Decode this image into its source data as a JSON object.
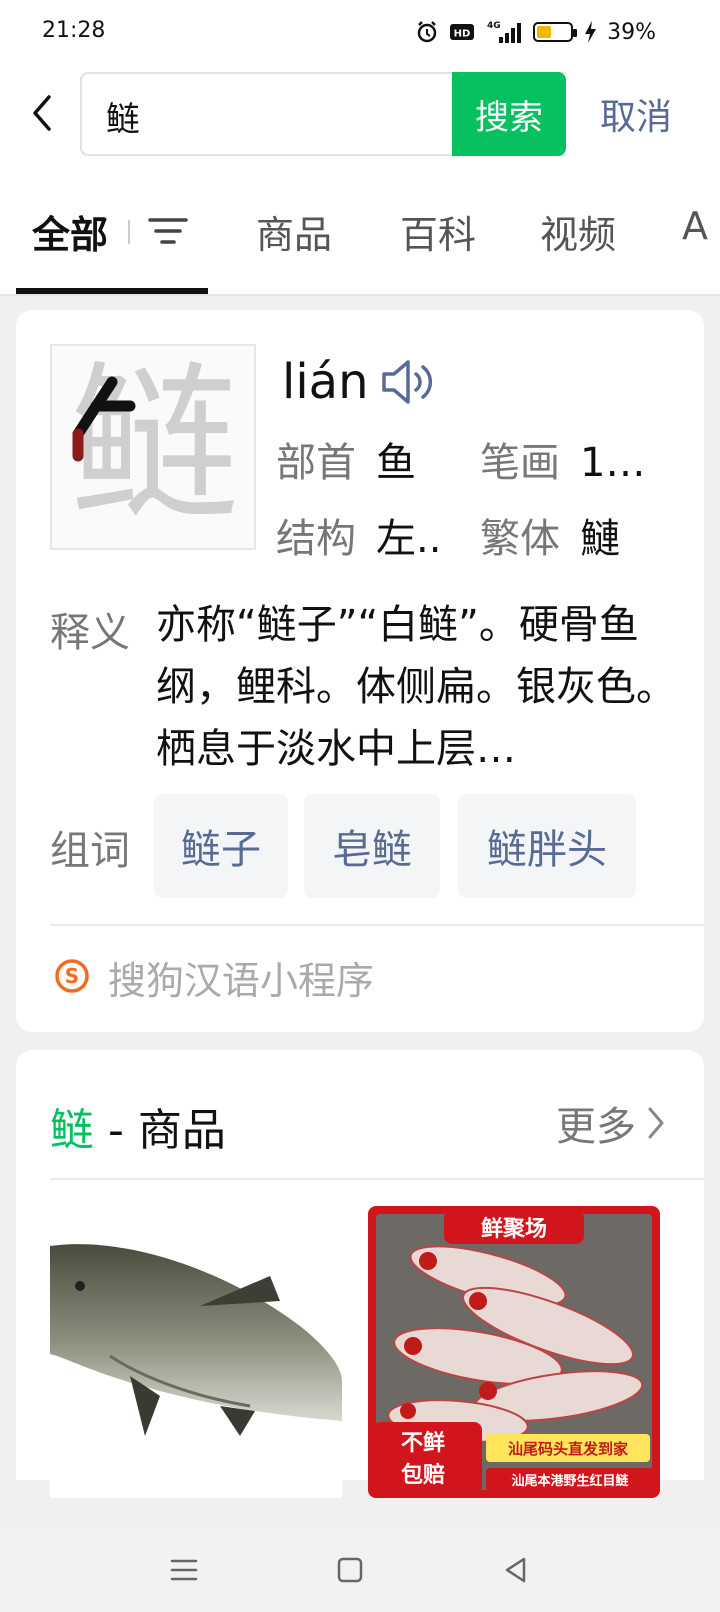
{
  "status_bar": {
    "time": "21:28",
    "battery_text": "39%",
    "battery_level": 0.39,
    "icons": [
      "alarm-icon",
      "hd-icon",
      "4g-signal-icon",
      "battery-icon",
      "charging-icon"
    ]
  },
  "search": {
    "query": "鲢",
    "search_label": "搜索",
    "cancel_label": "取消"
  },
  "tabs": [
    {
      "label": "全部",
      "active": true
    },
    {
      "label": "商品",
      "active": false
    },
    {
      "label": "百科",
      "active": false
    },
    {
      "label": "视频",
      "active": false
    },
    {
      "label": "A",
      "active": false
    }
  ],
  "dict_card": {
    "character": "鲢",
    "pinyin": "lián",
    "radical_label": "部首",
    "radical_value": "鱼",
    "strokes_label": "笔画",
    "strokes_value": "1…",
    "structure_label": "结构",
    "structure_value": "左..",
    "traditional_label": "繁体",
    "traditional_value": "鰱",
    "definition_label": "释义",
    "definition_text": "亦称“鲢子”“白鲢”。硬骨鱼纲，鲤科。体侧扁。银灰色。栖息于淡水中上层…",
    "words_label": "组词",
    "words": [
      "鲢子",
      "皂鲢",
      "鲢胖头"
    ],
    "source": "搜狗汉语小程序"
  },
  "goods_card": {
    "keyword": "鲢",
    "separator": " - ",
    "section_title": "商品",
    "more_label": "更多",
    "product2": {
      "banner": "鲜聚场",
      "badge_line1": "不鲜",
      "badge_line2": "包赔",
      "tag1": "汕尾码头直发到家",
      "tag2": "汕尾本港野生红目鲢"
    }
  },
  "colors": {
    "accent_green": "#07c160",
    "link_blue": "#576b95"
  }
}
